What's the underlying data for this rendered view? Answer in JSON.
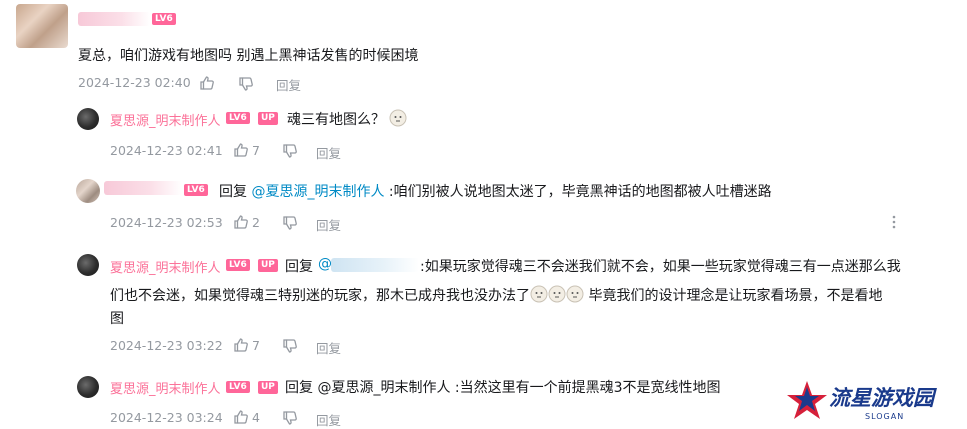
{
  "comment_main": {
    "level": "LV6",
    "text": "夏总，咱们游戏有地图吗 别遇上黑神话发售的时候困境",
    "time": "2024-12-23 02:40",
    "reply_label": "回复"
  },
  "replies": [
    {
      "username": "夏思源_明末制作人",
      "level": "LV6",
      "up_badge": "UP",
      "text": "魂三有地图么？",
      "time": "2024-12-23 02:41",
      "likes": "7",
      "reply_label": "回复"
    },
    {
      "level": "LV6",
      "reply_prefix": "回复",
      "mention": "@夏思源_明末制作人",
      "text": ":咱们别被人说地图太迷了，毕竟黑神话的地图都被人吐槽迷路",
      "time": "2024-12-23 02:53",
      "likes": "2",
      "reply_label": "回复"
    },
    {
      "username": "夏思源_明末制作人",
      "level": "LV6",
      "up_badge": "UP",
      "reply_prefix": "回复",
      "mention_at": "@",
      "text_line1": ":如果玩家觉得魂三不会迷我们就不会，如果一些玩家觉得魂三有一点迷那么我",
      "text_line2": "们也不会迷，如果觉得魂三特别迷的玩家，那木已成舟我也没办法了",
      "text_line2_tail": " 毕竟我们的设计理念是让玩家看场景，不是看地",
      "text_line3": "图",
      "time": "2024-12-23 03:22",
      "likes": "7",
      "reply_label": "回复"
    },
    {
      "username": "夏思源_明末制作人",
      "level": "LV6",
      "up_badge": "UP",
      "text": "回复 @夏思源_明末制作人 :当然这里有一个前提黑魂3不是宽线性地图",
      "time": "2024-12-23 03:24",
      "likes": "4",
      "reply_label": "回复"
    }
  ],
  "watermark": {
    "title": "流星游戏园",
    "subtitle": "SLOGAN"
  },
  "colors": {
    "username": "#fb7299",
    "mention": "#008ac5",
    "meta": "#9499a0",
    "badge": "#ff6699"
  },
  "icons": [
    "thumb-up-icon",
    "thumb-down-icon",
    "more-icon",
    "emoji-icon"
  ]
}
